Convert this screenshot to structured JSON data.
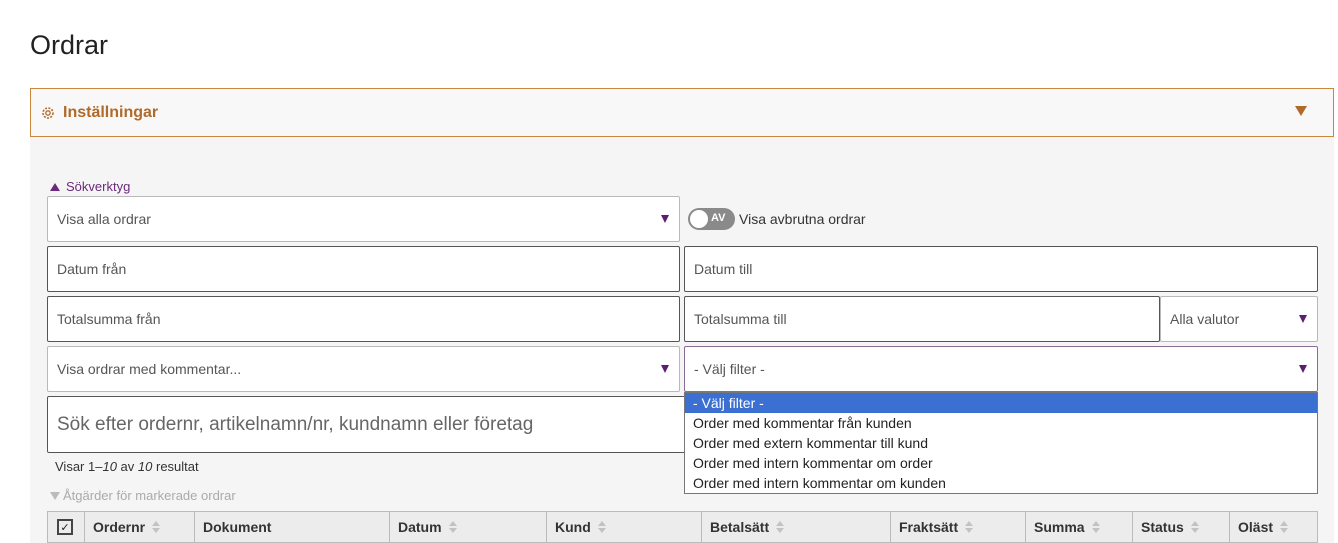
{
  "page": {
    "title": "Ordrar"
  },
  "settings": {
    "label": "Inställningar",
    "icon": "gear-icon"
  },
  "search_tools": {
    "label": "Sökverktyg",
    "order_filter": "Visa alla ordrar",
    "toggle_state": "AV",
    "toggle_label": "Visa avbrutna ordrar",
    "date_from": "Datum från",
    "date_to": "Datum till",
    "total_from": "Totalsumma från",
    "total_to": "Totalsumma till",
    "currency": "Alla valutor",
    "comment_filter": "Visa ordrar med kommentar...",
    "filter_select": "- Välj filter -",
    "search_placeholder": "Sök efter ordernr, artikelnamn/nr, kundnamn eller företag"
  },
  "filter_dropdown": {
    "options": [
      "- Välj filter -",
      "Order med kommentar från kunden",
      "Order med extern kommentar till kund",
      "Order med intern kommentar om order",
      "Order med intern kommentar om kunden"
    ],
    "selected_index": 0
  },
  "results": {
    "prefix": "Visar 1–",
    "shown": "10",
    "middle": " av ",
    "total": "10",
    "suffix": " resultat"
  },
  "actions": {
    "label": "Åtgärder för markerade ordrar"
  },
  "table": {
    "columns": [
      "Ordernr",
      "Dokument",
      "Datum",
      "Kund",
      "Betalsätt",
      "Fraktsätt",
      "Summa",
      "Status",
      "Oläst"
    ]
  },
  "colors": {
    "accent": "#b06a2b",
    "purple": "#6b2a7c",
    "selected": "#3b6fd1"
  }
}
